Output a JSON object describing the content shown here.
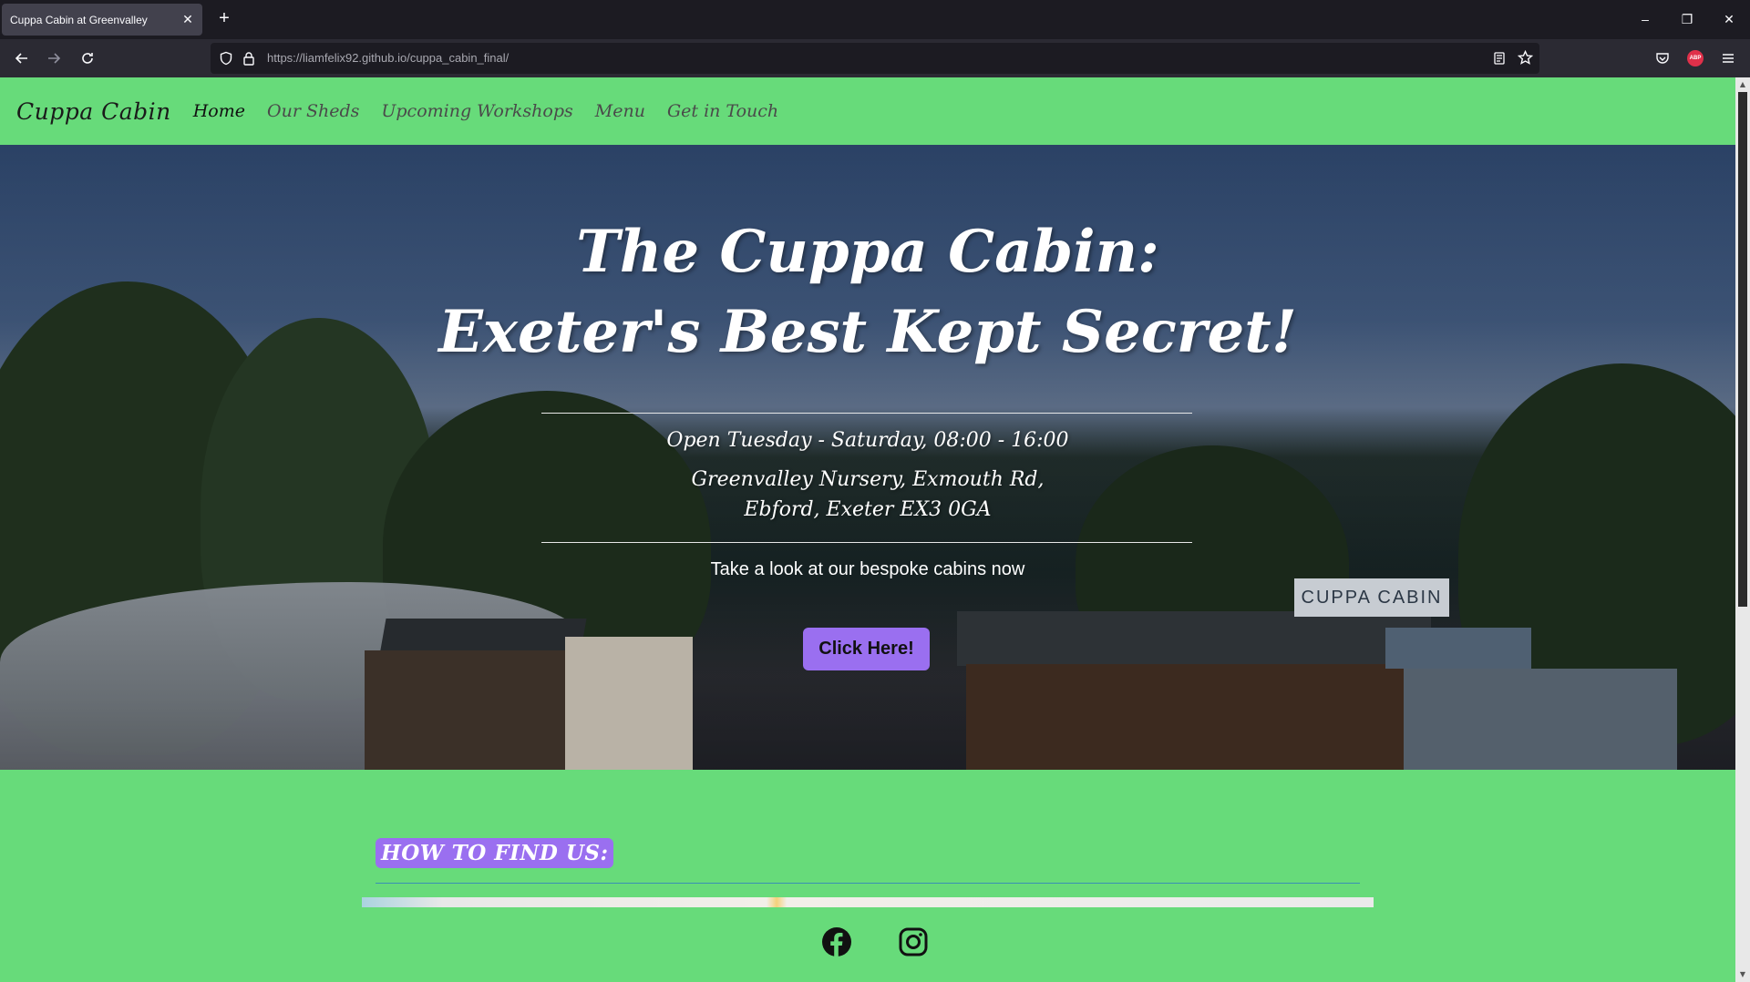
{
  "browser": {
    "tab_title": "Cuppa Cabin at Greenvalley",
    "url_host": "https://liamfelix92.github.io",
    "url_path": "/cuppa_cabin_final/",
    "extension_badge": "ABP"
  },
  "site": {
    "brand": "Cuppa Cabin",
    "nav": [
      {
        "label": "Home",
        "active": true
      },
      {
        "label": "Our Sheds",
        "active": false
      },
      {
        "label": "Upcoming Workshops",
        "active": false
      },
      {
        "label": "Menu",
        "active": false
      },
      {
        "label": "Get in Touch",
        "active": false
      }
    ],
    "background_color": "#67db7a",
    "accent_color": "#9a6ff0"
  },
  "hero": {
    "title_line1": "The Cuppa Cabin:",
    "title_line2": "Exeter's Best Kept Secret!",
    "hours": "Open Tuesday - Saturday, 08:00 - 16:00",
    "address_line1": "Greenvalley Nursery, Exmouth Rd,",
    "address_line2": "Ebford, Exeter EX3 0GA",
    "cta_text": "Take a look at our bespoke cabins now",
    "cta_button": "Click Here!",
    "sign_text": "CUPPA CABIN"
  },
  "find_us": {
    "heading": "HOW TO FIND US:"
  },
  "social": {
    "icons": [
      "facebook-icon",
      "instagram-icon"
    ]
  }
}
